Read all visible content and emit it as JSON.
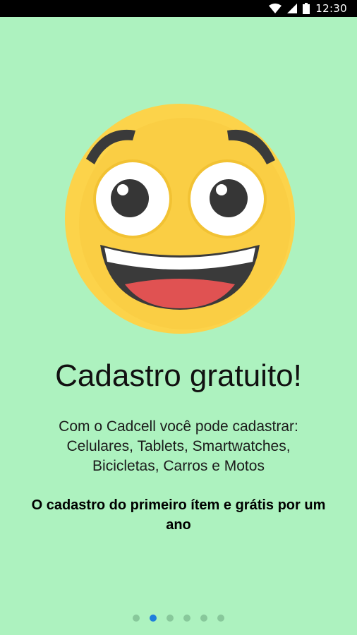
{
  "status_bar": {
    "time": "12:30",
    "icons": [
      "wifi-icon",
      "signal-icon",
      "battery-icon"
    ]
  },
  "onboarding": {
    "illustration": "grinning-emoji",
    "title": "Cadastro gratuito!",
    "description_lines": [
      "Com o Cadcell você pode cadastrar:",
      "Celulares, Tablets, Smartwatches,",
      "Bicicletas, Carros e Motos"
    ],
    "note": "O cadastro do primeiro ítem e grátis por um ano"
  },
  "pager": {
    "total": 6,
    "active_index": 1
  },
  "colors": {
    "background": "#adf2bf",
    "title_text": "#111111",
    "dot_active": "#1f7fdc",
    "dot_inactive": "#88c89b",
    "emoji_face": "#fcd34a",
    "emoji_tongue": "#e05252"
  }
}
